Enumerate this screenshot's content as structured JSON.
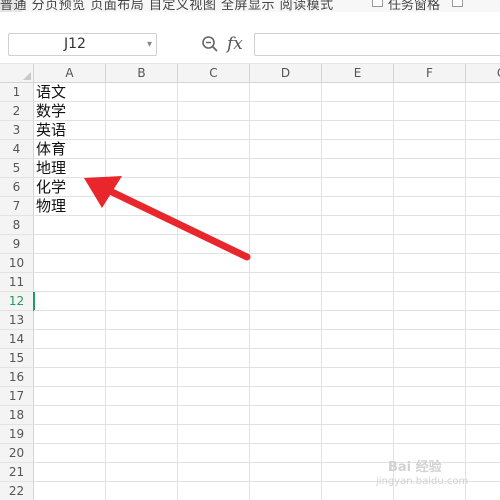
{
  "toolbar": {
    "text": "普通  分页预览  页面布局  自定义视图  全屏显示  阅读模式",
    "checkbox_label": "任务窗格"
  },
  "formula_bar": {
    "name_box_value": "J12",
    "name_box_arrow": "▾",
    "fx_label": "fx",
    "formula_value": ""
  },
  "grid": {
    "columns": [
      "A",
      "B",
      "C",
      "D",
      "E",
      "F",
      "G"
    ],
    "rows": [
      "1",
      "2",
      "3",
      "4",
      "5",
      "6",
      "7",
      "8",
      "9",
      "10",
      "11",
      "12",
      "13",
      "14",
      "15",
      "16",
      "17",
      "18",
      "19",
      "20",
      "21",
      "22",
      "23"
    ],
    "active_row": "12",
    "cells_col_a": [
      "语文",
      "数学",
      "英语",
      "体育",
      "地理",
      "化学",
      "物理"
    ]
  },
  "annotation": {
    "arrow_color": "#e8262c"
  },
  "watermark": {
    "brand": "Bai 经验",
    "sub": "jingyan.baidu.com"
  }
}
